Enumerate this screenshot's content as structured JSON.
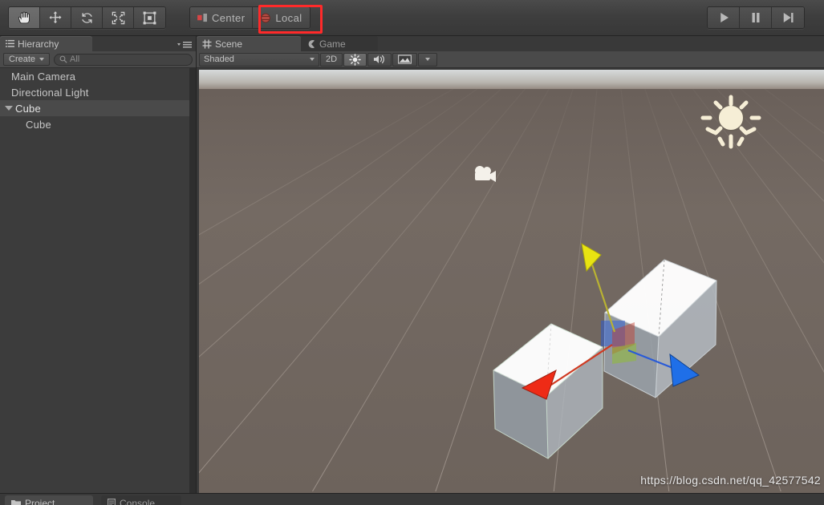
{
  "toolbar": {
    "transform_tools": [
      {
        "name": "hand-tool",
        "tooltip": "Hand Tool",
        "active": true
      },
      {
        "name": "move-tool",
        "tooltip": "Move Tool",
        "active": false
      },
      {
        "name": "rotate-tool",
        "tooltip": "Rotate Tool",
        "active": false
      },
      {
        "name": "scale-tool",
        "tooltip": "Scale Tool",
        "active": false
      },
      {
        "name": "rect-tool",
        "tooltip": "Rect Transform",
        "active": false
      }
    ],
    "pivot_mode_label": "Center",
    "pivot_rotation_label": "Local",
    "highlight_color": "#ff2a2a",
    "highlighted_control": "Local",
    "play_label": "Play",
    "pause_label": "Pause",
    "step_label": "Step"
  },
  "hierarchy": {
    "tab_label": "Hierarchy",
    "create_label": "Create",
    "search_placeholder": "All",
    "search_value": "",
    "items": [
      {
        "label": "Main Camera",
        "depth": 0,
        "selected": false,
        "expandable": false
      },
      {
        "label": "Directional Light",
        "depth": 0,
        "selected": false,
        "expandable": false
      },
      {
        "label": "Cube",
        "depth": 0,
        "selected": true,
        "expandable": true
      },
      {
        "label": "Cube",
        "depth": 1,
        "selected": false,
        "expandable": false
      }
    ]
  },
  "scene": {
    "tabs": [
      {
        "label": "Scene",
        "selected": true
      },
      {
        "label": "Game",
        "selected": false
      }
    ],
    "draw_mode": "Shaded",
    "view_mode_2d": "2D",
    "lighting_label": "Lighting",
    "audio_label": "Audio",
    "effects_label": "Effects",
    "gizmos": [
      {
        "name": "directional-light-gizmo",
        "label": "Directional Light"
      },
      {
        "name": "camera-gizmo",
        "label": "Main Camera"
      }
    ],
    "objects": [
      {
        "name": "cube-child",
        "label": "Cube"
      },
      {
        "name": "cube-parent",
        "label": "Cube"
      }
    ],
    "move_gizmo": {
      "x_axis_color": "#ee2b16",
      "y_axis_color": "#e8e312",
      "z_axis_color": "#1f6fe8"
    },
    "watermark": "https://blog.csdn.net/qq_42577542"
  },
  "bottom": {
    "tabs": [
      {
        "label": "Project",
        "selected": true
      },
      {
        "label": "Console",
        "selected": false
      }
    ]
  }
}
